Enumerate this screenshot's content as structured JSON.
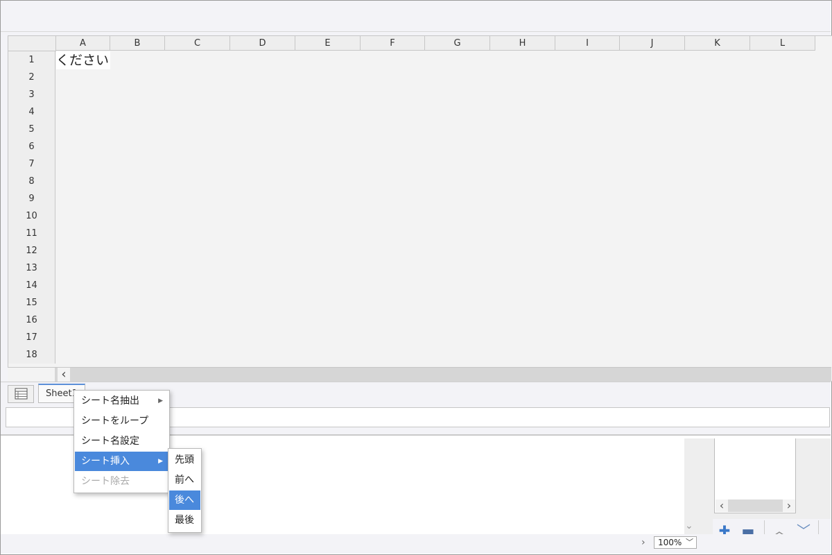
{
  "grid": {
    "columns": [
      "A",
      "B",
      "C",
      "D",
      "E",
      "F",
      "G",
      "H",
      "I",
      "J",
      "K",
      "L"
    ],
    "rows": [
      "1",
      "2",
      "3",
      "4",
      "5",
      "6",
      "7",
      "8",
      "9",
      "10",
      "11",
      "12",
      "13",
      "14",
      "15",
      "16",
      "17",
      "18"
    ],
    "cell_a1": "ください"
  },
  "sheet_tab": {
    "label": "Sheet1"
  },
  "context_menu": {
    "items": [
      {
        "label": "シート名抽出",
        "has_submenu": true
      },
      {
        "label": "シートをループ"
      },
      {
        "label": "シート名設定"
      },
      {
        "label": "シート挿入",
        "has_submenu": true,
        "selected": true
      },
      {
        "label": "シート除去",
        "disabled": true
      }
    ]
  },
  "submenu": {
    "items": [
      {
        "label": "先頭"
      },
      {
        "label": "前へ"
      },
      {
        "label": "後へ",
        "selected": true
      },
      {
        "label": "最後"
      }
    ]
  },
  "status": {
    "zoom": "100%"
  },
  "icons": {
    "scroll_left": "chevron-left-icon",
    "scroll_right": "chevron-right-icon",
    "add": "plus-icon",
    "remove": "minus-icon",
    "up": "chevron-up-icon",
    "down": "chevron-down-icon",
    "sheet_list": "sheet-list-icon"
  },
  "colors": {
    "selection": "#4a89dc",
    "accent_plus": "#3a78c8"
  }
}
